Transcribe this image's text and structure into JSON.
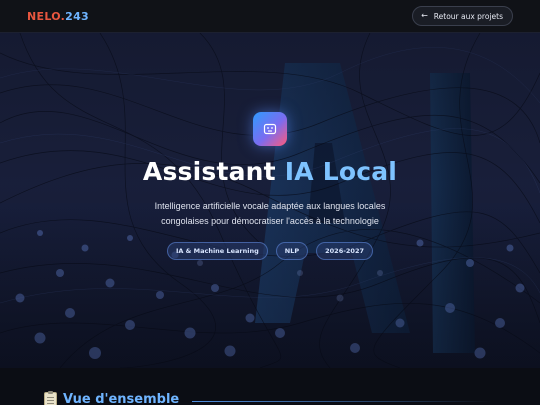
{
  "header": {
    "logo_part1": "NELO.",
    "logo_part2": "243",
    "back_label": "Retour aux projets",
    "back_icon": "arrow-left-icon"
  },
  "hero": {
    "app_icon": "robot-face-icon",
    "title_part1": "Assistant ",
    "title_part2": "IA Local",
    "subtitle": "Intelligence artificielle vocale adaptée aux langues locales congolaises pour démocratiser l'accès à la technologie",
    "tags": [
      "IA & Machine Learning",
      "NLP",
      "2026-2027"
    ]
  },
  "section": {
    "icon": "clipboard-icon",
    "title": "Vue d'ensemble"
  },
  "colors": {
    "accent_blue": "#6fb4ff",
    "brand_red": "#e8563f",
    "background": "#0b0d14"
  }
}
